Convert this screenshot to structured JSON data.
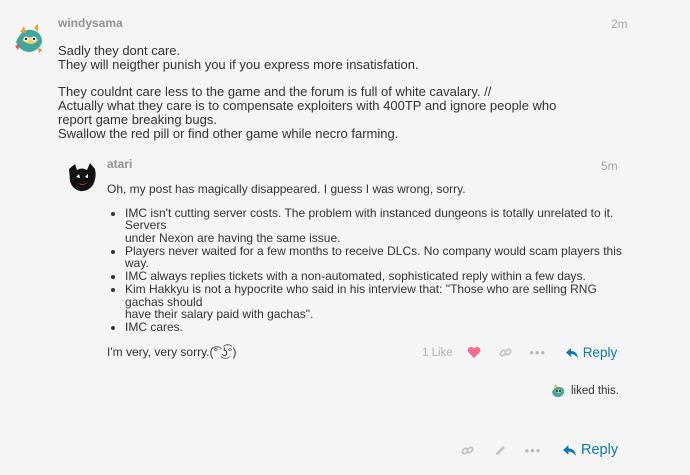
{
  "post": {
    "username": "windysama",
    "time": "2m",
    "paragraphs": [
      [
        "Sadly they dont care.",
        "They will neigther punish you if you express more insatisfation."
      ],
      [
        "They couldnt care less to the game and the forum is full of white cavalary. //",
        "Actually what they care is to compensate exploiters with 400TP and ignore people who report game breaking bugs.",
        "Swallow the red pill or find other game while necro farming."
      ]
    ]
  },
  "reply": {
    "username": "atari",
    "time": "5m",
    "intro": "Oh, my post has magically disappeared. I guess I was wrong, sorry.",
    "bullets": [
      [
        "IMC isn't cutting server costs. The problem with instanced dungeons is totally unrelated to it. Servers",
        "under Nexon are having the same issue."
      ],
      [
        "Players never waited for a few months to receive DLCs. No company would scam players this way."
      ],
      [
        "IMC always replies tickets with a non-automated, sophisticated reply within a few days."
      ],
      [
        "Kim Hakkyu is not a hypocrite who said in his interview that: \"Those who are selling RNG gachas should",
        "have their salary paid with gachas\"."
      ],
      [
        "IMC cares."
      ]
    ],
    "outro": "I'm very, very sorry.(͡° ͜ʖ͡°)",
    "like_count": "1 Like",
    "reply_label": "Reply"
  },
  "liked": {
    "text": "liked this."
  },
  "bottom": {
    "reply_label": "Reply"
  },
  "colors": {
    "link": "#0a78b4",
    "heart": "#fa6c8d",
    "muted": "#b9b9b9"
  }
}
